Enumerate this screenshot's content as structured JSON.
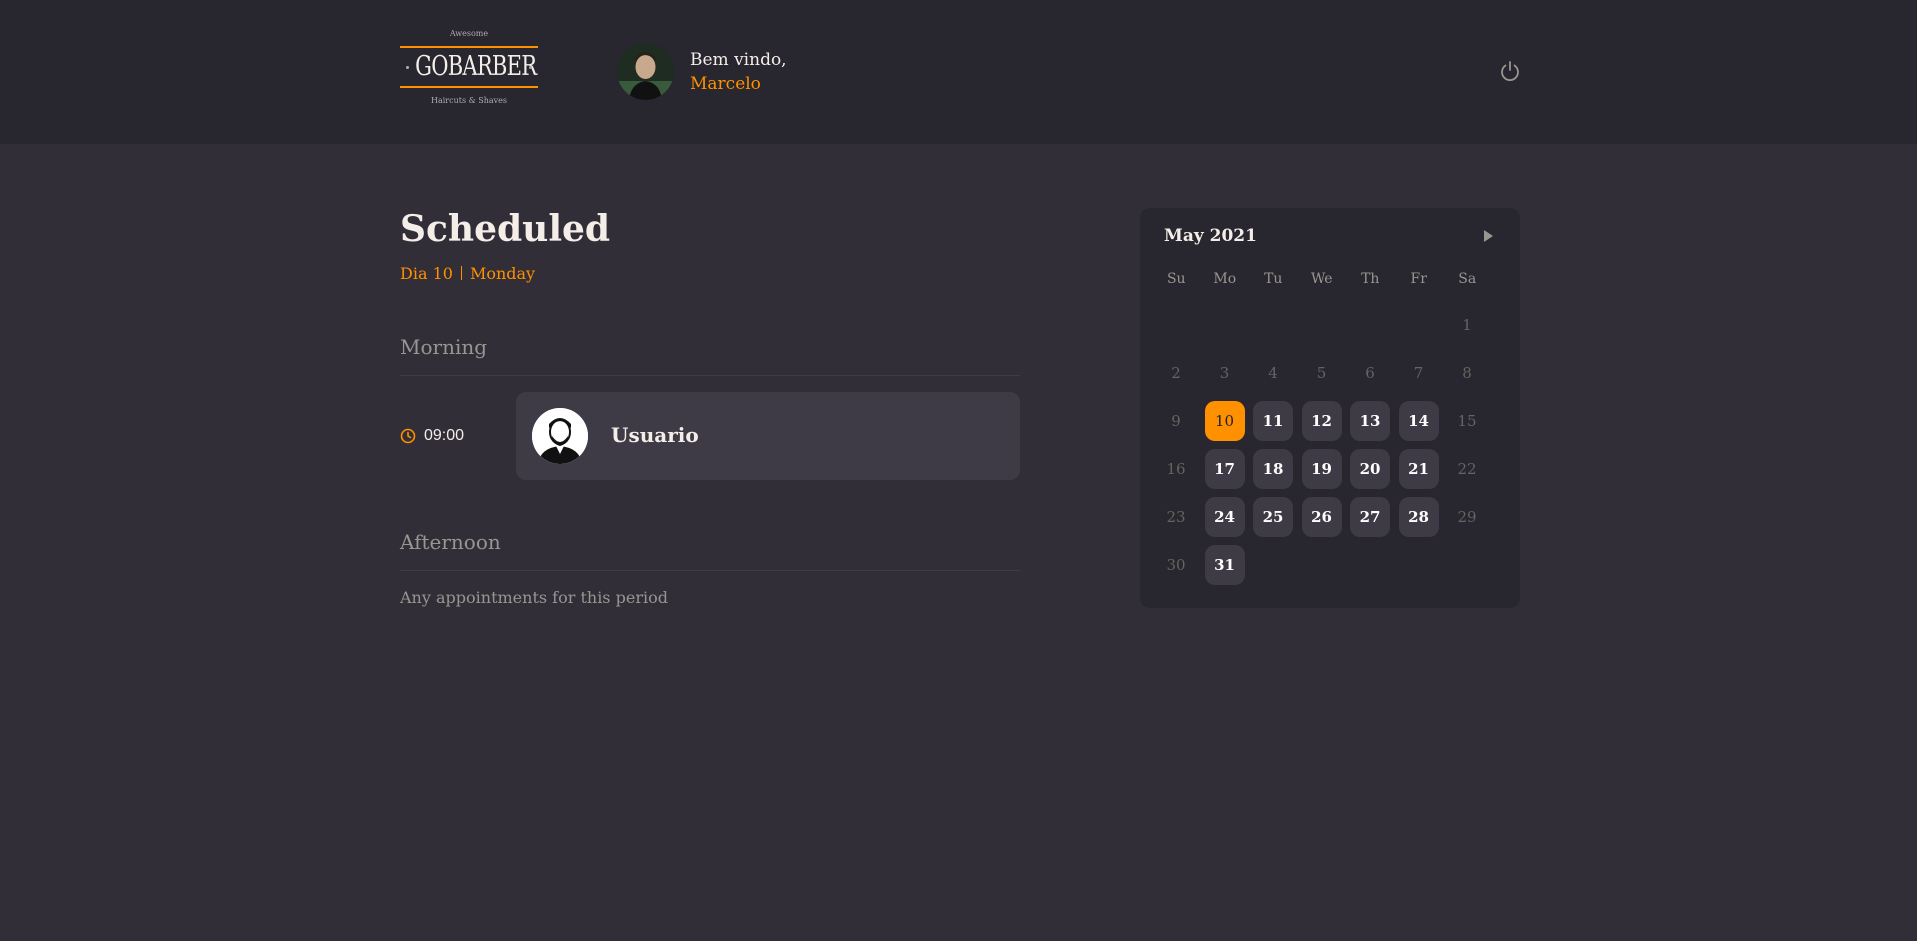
{
  "header": {
    "logo": {
      "top_text": "Awesome",
      "brand": "GOBARBER",
      "bottom_text": "Haircuts & Shaves"
    },
    "welcome_text": "Bem vindo,",
    "user_name": "Marcelo",
    "signout_icon": "power-icon"
  },
  "schedule": {
    "title": "Scheduled",
    "day_label": "Dia 10",
    "weekday_label": "Monday",
    "morning": {
      "label": "Morning",
      "appointments": [
        {
          "time": "09:00",
          "client": "Usuario"
        }
      ]
    },
    "afternoon": {
      "label": "Afternoon",
      "empty_text": "Any appointments for this period"
    }
  },
  "calendar": {
    "caption": "May 2021",
    "next_icon": "triangle-right-icon",
    "weekdays": [
      "Su",
      "Mo",
      "Tu",
      "We",
      "Th",
      "Fr",
      "Sa"
    ],
    "days": [
      {
        "d": "",
        "s": "blank"
      },
      {
        "d": "",
        "s": "blank"
      },
      {
        "d": "",
        "s": "blank"
      },
      {
        "d": "",
        "s": "blank"
      },
      {
        "d": "",
        "s": "blank"
      },
      {
        "d": "",
        "s": "blank"
      },
      {
        "d": "1",
        "s": "disabled"
      },
      {
        "d": "2",
        "s": "disabled"
      },
      {
        "d": "3",
        "s": "disabled"
      },
      {
        "d": "4",
        "s": "disabled"
      },
      {
        "d": "5",
        "s": "disabled"
      },
      {
        "d": "6",
        "s": "disabled"
      },
      {
        "d": "7",
        "s": "disabled"
      },
      {
        "d": "8",
        "s": "disabled"
      },
      {
        "d": "9",
        "s": "disabled"
      },
      {
        "d": "10",
        "s": "selected"
      },
      {
        "d": "11",
        "s": "avail"
      },
      {
        "d": "12",
        "s": "avail"
      },
      {
        "d": "13",
        "s": "avail"
      },
      {
        "d": "14",
        "s": "avail"
      },
      {
        "d": "15",
        "s": "disabled"
      },
      {
        "d": "16",
        "s": "disabled"
      },
      {
        "d": "17",
        "s": "avail"
      },
      {
        "d": "18",
        "s": "avail"
      },
      {
        "d": "19",
        "s": "avail"
      },
      {
        "d": "20",
        "s": "avail"
      },
      {
        "d": "21",
        "s": "avail"
      },
      {
        "d": "22",
        "s": "disabled"
      },
      {
        "d": "23",
        "s": "disabled"
      },
      {
        "d": "24",
        "s": "avail"
      },
      {
        "d": "25",
        "s": "avail"
      },
      {
        "d": "26",
        "s": "avail"
      },
      {
        "d": "27",
        "s": "avail"
      },
      {
        "d": "28",
        "s": "avail"
      },
      {
        "d": "29",
        "s": "disabled"
      },
      {
        "d": "30",
        "s": "disabled"
      },
      {
        "d": "31",
        "s": "avail"
      }
    ]
  },
  "colors": {
    "accent": "#ff9000",
    "background": "#312e38",
    "header": "#28262e",
    "card": "#3e3b47"
  }
}
